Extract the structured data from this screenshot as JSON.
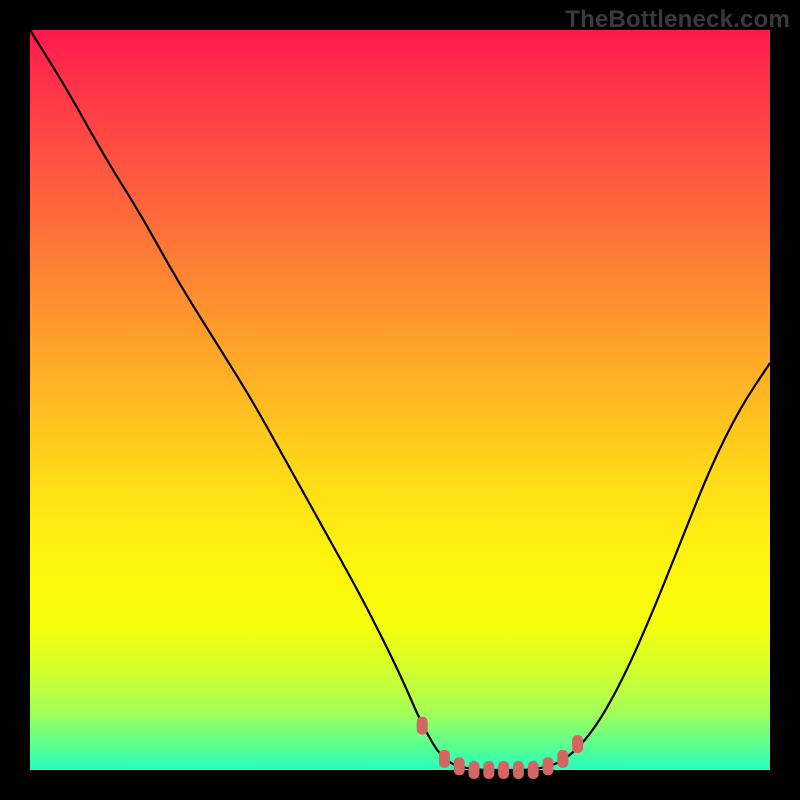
{
  "watermark": "TheBottleneck.com",
  "colors": {
    "frame": "#000000",
    "curve": "#000000",
    "marker": "#d36663"
  },
  "chart_data": {
    "type": "line",
    "title": "",
    "xlabel": "",
    "ylabel": "",
    "xlim": [
      0,
      100
    ],
    "ylim": [
      0,
      100
    ],
    "x": [
      0,
      5,
      10,
      15,
      20,
      25,
      30,
      35,
      40,
      45,
      50,
      53,
      56,
      60,
      64,
      68,
      72,
      76,
      80,
      84,
      88,
      92,
      96,
      100
    ],
    "values": [
      100,
      92,
      83,
      75,
      66,
      58,
      50,
      41,
      32,
      23,
      13,
      6,
      1,
      0,
      0,
      0,
      1,
      5,
      12,
      21,
      31,
      41,
      49,
      55
    ],
    "flat_range_x": [
      53,
      72
    ],
    "markers": [
      {
        "x": 53,
        "y": 6
      },
      {
        "x": 56,
        "y": 1.5
      },
      {
        "x": 58,
        "y": 0.5
      },
      {
        "x": 60,
        "y": 0
      },
      {
        "x": 62,
        "y": 0
      },
      {
        "x": 64,
        "y": 0
      },
      {
        "x": 66,
        "y": 0
      },
      {
        "x": 68,
        "y": 0
      },
      {
        "x": 70,
        "y": 0.5
      },
      {
        "x": 72,
        "y": 1.5
      },
      {
        "x": 74,
        "y": 3.5
      }
    ]
  }
}
